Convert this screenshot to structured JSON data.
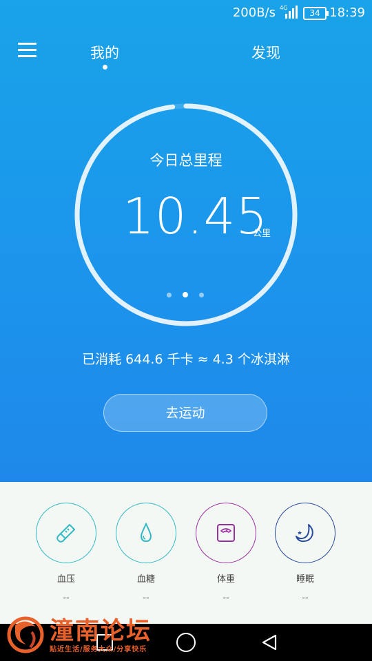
{
  "status_bar": {
    "speed": "200B/s",
    "network": "4G",
    "battery": "34",
    "time": "18:39"
  },
  "header": {
    "tabs": [
      {
        "label": "我的"
      },
      {
        "label": "发现"
      }
    ]
  },
  "ring": {
    "title": "今日总里程",
    "value": "10.45",
    "unit": "公里",
    "progress": 0.98,
    "page_count": 3,
    "active_page": 2
  },
  "consumed": "已消耗 644.6 千卡 ≈ 4.3 个冰淇淋",
  "go_button": "去运动",
  "health": [
    {
      "label": "血压",
      "value": "--",
      "icon": "thermometer-icon",
      "color": "#33b9c4"
    },
    {
      "label": "血糖",
      "value": "--",
      "icon": "water-drop-icon",
      "color": "#33b9c4"
    },
    {
      "label": "体重",
      "value": "--",
      "icon": "scale-icon",
      "color": "#9a2fa0"
    },
    {
      "label": "睡眠",
      "value": "--",
      "icon": "moon-icon",
      "color": "#274a9b"
    }
  ],
  "watermark": {
    "title": "潼南论坛",
    "subtitle": "贴近生活/服务大众/分享快乐"
  }
}
